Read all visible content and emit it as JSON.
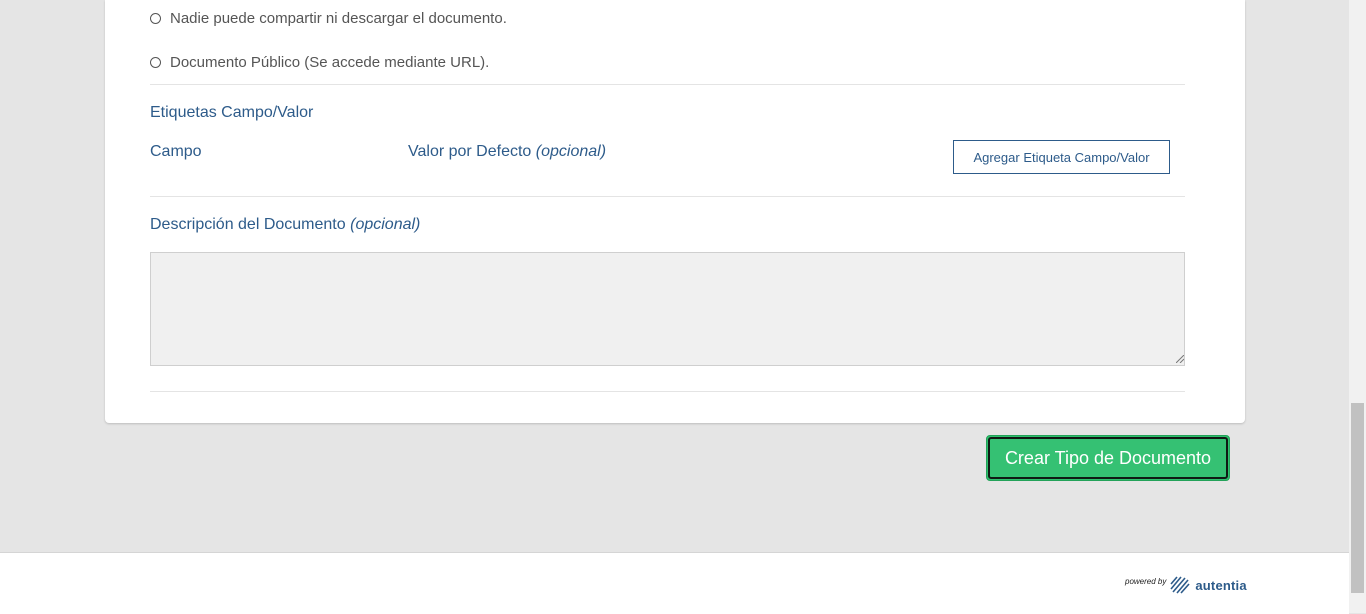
{
  "sharing_options": {
    "option_no_share": "Nadie puede compartir ni descargar el documento.",
    "option_public": "Documento Público (Se accede mediante URL)."
  },
  "tags": {
    "section_label": "Etiquetas Campo/Valor",
    "field_label": "Campo",
    "default_value_label": "Valor por Defecto",
    "optional": "(opcional)",
    "add_button": "Agregar Etiqueta Campo/Valor"
  },
  "description": {
    "label": "Descripción del Documento",
    "optional": "(opcional)",
    "value": ""
  },
  "actions": {
    "create_button": "Crear Tipo de Documento"
  },
  "footer": {
    "powered_by": "powered by",
    "brand": "autentia"
  },
  "colors": {
    "accent_blue": "#2d5b8a",
    "primary_green": "#35c173",
    "page_background": "#e5e5e5"
  }
}
